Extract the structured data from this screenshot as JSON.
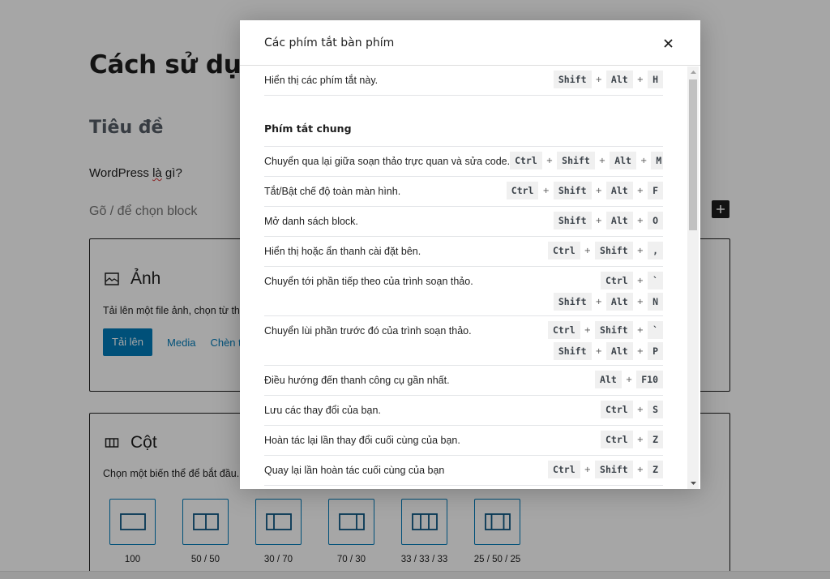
{
  "editor": {
    "post_title": "Cách sử dụng",
    "heading": "Tiêu đề",
    "paragraph_before": "WordPress ",
    "paragraph_misspelled": "là",
    "paragraph_after": " gì?",
    "placeholder": "Gõ / để chọn block",
    "inserter_label": "+",
    "image_block": {
      "label": "Ảnh",
      "icon": "image-icon",
      "instructions": "Tải lên một file ảnh, chọn từ thư viện",
      "upload_button": "Tải lên",
      "media_button": "Media",
      "insert_url_button": "Chèn từ URL"
    },
    "columns_block": {
      "label": "Cột",
      "icon": "columns-icon",
      "instructions": "Chọn một biến thể để bắt đầu.",
      "variations": [
        {
          "label": "100",
          "columns": [
            100
          ]
        },
        {
          "label": "50 / 50",
          "columns": [
            50,
            50
          ]
        },
        {
          "label": "30 / 70",
          "columns": [
            30,
            70
          ]
        },
        {
          "label": "70 / 30",
          "columns": [
            70,
            30
          ]
        },
        {
          "label": "33 / 33 / 33",
          "columns": [
            33,
            33,
            33
          ]
        },
        {
          "label": "25 / 50 / 25",
          "columns": [
            25,
            50,
            25
          ]
        }
      ]
    }
  },
  "modal": {
    "title": "Các phím tắt bàn phím",
    "close_icon": "close-icon",
    "top_shortcut": {
      "description": "Hiển thị các phím tắt này.",
      "combos": [
        [
          "Shift",
          "Alt",
          "H"
        ]
      ]
    },
    "sections": [
      {
        "title": "Phím tắt chung",
        "shortcuts": [
          {
            "description": "Chuyển qua lại giữa soạn thảo trực quan và sửa code.",
            "combos": [
              [
                "Ctrl",
                "Shift",
                "Alt",
                "M"
              ]
            ]
          },
          {
            "description": "Tắt/Bật chế độ toàn màn hình.",
            "combos": [
              [
                "Ctrl",
                "Shift",
                "Alt",
                "F"
              ]
            ]
          },
          {
            "description": "Mở danh sách block.",
            "combos": [
              [
                "Shift",
                "Alt",
                "O"
              ]
            ]
          },
          {
            "description": "Hiển thị hoặc ẩn thanh cài đặt bên.",
            "combos": [
              [
                "Ctrl",
                "Shift",
                ","
              ]
            ]
          },
          {
            "description": "Chuyển tới phần tiếp theo của trình soạn thảo.",
            "combos": [
              [
                "Ctrl",
                "`"
              ],
              [
                "Shift",
                "Alt",
                "N"
              ]
            ]
          },
          {
            "description": "Chuyển lùi phần trước đó của trình soạn thảo.",
            "combos": [
              [
                "Ctrl",
                "Shift",
                "`"
              ],
              [
                "Shift",
                "Alt",
                "P"
              ]
            ]
          },
          {
            "description": "Điều hướng đến thanh công cụ gần nhất.",
            "combos": [
              [
                "Alt",
                "F10"
              ]
            ]
          },
          {
            "description": "Lưu các thay đổi của bạn.",
            "combos": [
              [
                "Ctrl",
                "S"
              ]
            ]
          },
          {
            "description": "Hoàn tác lại lần thay đổi cuối cùng của bạn.",
            "combos": [
              [
                "Ctrl",
                "Z"
              ]
            ]
          },
          {
            "description": "Quay lại lần hoàn tác cuối cùng của bạn",
            "combos": [
              [
                "Ctrl",
                "Shift",
                "Z"
              ]
            ]
          }
        ]
      }
    ],
    "plus_separator": "+",
    "scrollbar": {
      "position_fraction": 0.0,
      "visible_fraction": 0.38
    }
  },
  "colors": {
    "accent": "#007cba",
    "overlay": "rgba(0,0,0,0.35)",
    "key_bg": "#f0f0f0",
    "text": "#1e1e1e"
  }
}
